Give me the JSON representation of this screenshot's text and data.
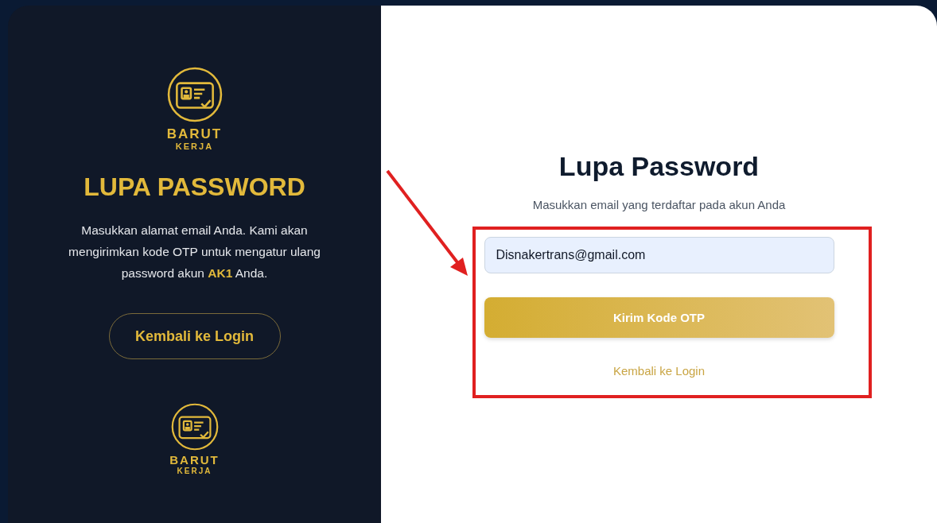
{
  "brand_panel": {
    "logo_top": {
      "line_1": "BARUT",
      "line_2": "KERJA"
    },
    "title": "LUPA PASSWORD",
    "description": "Masukkan alamat email Anda. Kami akan mengirimkan kode OTP untuk mengatur ulang password akun **AK1** Anda.",
    "back_button": "Kembali ke Login",
    "logo_bottom": {
      "line_1": "BARUT",
      "line_2": "KERJA"
    }
  },
  "form_panel": {
    "title": "Lupa Password",
    "subtitle": "Masukkan email yang terdaftar pada akun Anda",
    "email_field": {
      "value": "Disnakertrans@gmail.com"
    },
    "submit_button": "Kirim Kode OTP",
    "back_link": "Kembali ke Login"
  }
}
